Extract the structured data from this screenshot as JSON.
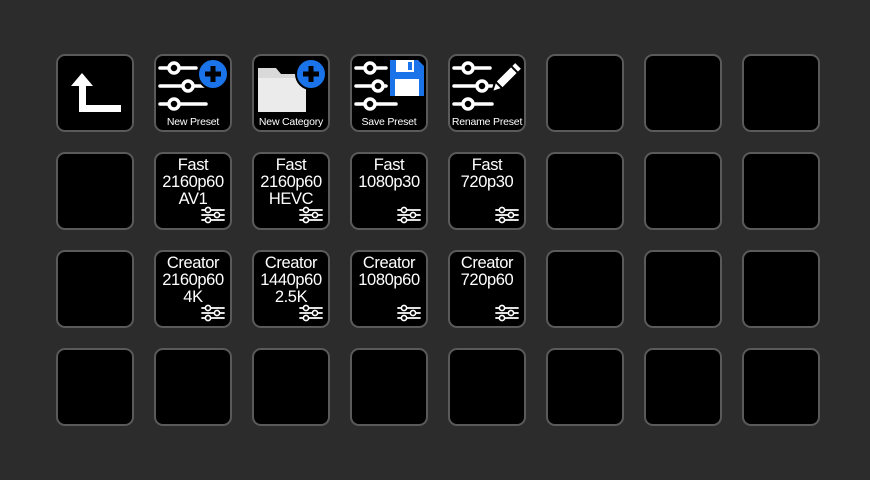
{
  "deck": {
    "columns": 8,
    "rows": 4,
    "colors": {
      "key_background": "#000000",
      "key_border": "#5a5a5a",
      "page_background": "#2c2c2c",
      "accent_blue": "#1a73e8",
      "icon_white": "#ffffff",
      "folder_gray": "#d9d9d9"
    },
    "action_keys": [
      {
        "icon": "back-arrow-icon",
        "label": ""
      },
      {
        "icon": "sliders-add-icon",
        "label": "New Preset"
      },
      {
        "icon": "folder-add-icon",
        "label": "New Category"
      },
      {
        "icon": "sliders-save-icon",
        "label": "Save Preset"
      },
      {
        "icon": "sliders-edit-icon",
        "label": "Rename Preset"
      }
    ],
    "preset_rows": [
      [
        {
          "lines": [
            "Fast",
            "2160p60",
            "AV1"
          ],
          "icon": "sliders-icon"
        },
        {
          "lines": [
            "Fast",
            "2160p60",
            "HEVC"
          ],
          "icon": "sliders-icon"
        },
        {
          "lines": [
            "Fast",
            "1080p30"
          ],
          "icon": "sliders-icon"
        },
        {
          "lines": [
            "Fast",
            "720p30"
          ],
          "icon": "sliders-icon"
        }
      ],
      [
        {
          "lines": [
            "Creator",
            "2160p60",
            "4K"
          ],
          "icon": "sliders-icon"
        },
        {
          "lines": [
            "Creator",
            "1440p60",
            "2.5K"
          ],
          "icon": "sliders-icon"
        },
        {
          "lines": [
            "Creator",
            "1080p60"
          ],
          "icon": "sliders-icon"
        },
        {
          "lines": [
            "Creator",
            "720p60"
          ],
          "icon": "sliders-icon"
        }
      ]
    ]
  }
}
